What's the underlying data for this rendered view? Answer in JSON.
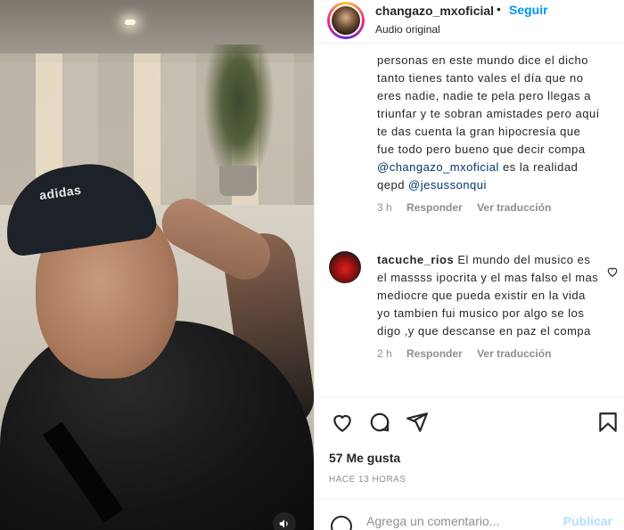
{
  "header": {
    "username": "changazo_mxoficial",
    "separator": "•",
    "follow_label": "Seguir",
    "audio_label": "Audio original",
    "more_label": "···"
  },
  "comment1": {
    "text_before": "personas en este mundo dice el dicho tanto tienes tanto vales el día que no eres nadie, nadie te pela pero llegas a triunfar y te sobran amistades pero aquí te das cuenta la gran hipocresía que fue todo pero bueno que decir compa",
    "mention1": "@changazo_mxoficial",
    "text_middle": "es la realidad qepd",
    "mention2": "@jesussonqui",
    "time": "3 h",
    "reply_label": "Responder",
    "translate_label": "Ver traducción"
  },
  "comment2": {
    "username": "tacuche_rios",
    "text": "El mundo del musico es el massss ipocrita y el mas falso el mas mediocre que pueda existir en la vida yo tambien fui musico por algo se los digo ,y que descanse en paz el compa",
    "time": "2 h",
    "reply_label": "Responder",
    "translate_label": "Ver traducción"
  },
  "actions": {
    "like_icon": "heart-icon",
    "comment_icon": "comment-icon",
    "share_icon": "paper-plane-icon",
    "save_icon": "bookmark-icon"
  },
  "likes_label": "57 Me gusta",
  "time_ago": "HACE 13 HORAS",
  "add_comment": {
    "placeholder": "Agrega un comentario...",
    "publish_label": "Publicar"
  },
  "media": {
    "cap_logo": "adidas",
    "sound_icon": "speaker-icon"
  },
  "colors": {
    "accent": "#0095f6",
    "publish_disabled": "#b2dffc",
    "mention": "#00376b"
  }
}
